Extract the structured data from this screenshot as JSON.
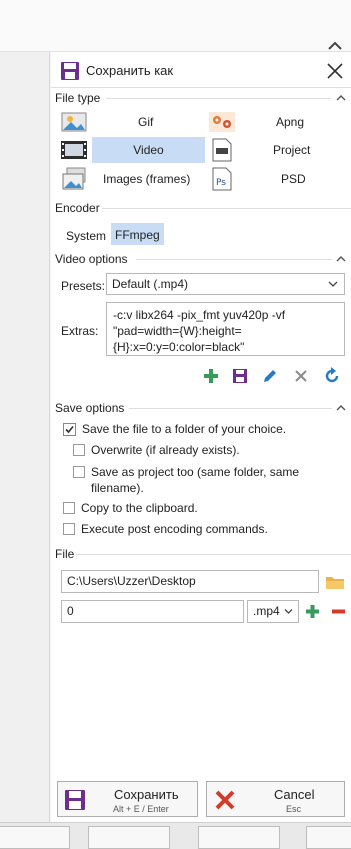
{
  "window": {
    "title": "Сохранить как"
  },
  "file_type": {
    "header": "File type",
    "items": [
      {
        "label": "Gif",
        "icon": "image-icon",
        "selected": false
      },
      {
        "label": "Apng",
        "icon": "flowers-icon",
        "selected": false
      },
      {
        "label": "Video",
        "icon": "film-icon",
        "selected": true
      },
      {
        "label": "Project",
        "icon": "project-file-icon",
        "selected": false
      },
      {
        "label": "Images (frames)",
        "icon": "images-icon",
        "selected": false
      },
      {
        "label": "PSD",
        "icon": "photoshop-file-icon",
        "selected": false
      }
    ]
  },
  "encoder": {
    "header": "Encoder",
    "tabs": [
      "System",
      "FFmpeg"
    ],
    "active_tab": "FFmpeg"
  },
  "video_options": {
    "header": "Video options",
    "presets_label": "Presets:",
    "presets_value": "Default (.mp4)",
    "extras_label": "Extras:",
    "extras_value": "-c:v libx264 -pix_fmt yuv420p -vf \"pad=width={W}:height={H}:x=0:y=0:color=black\""
  },
  "save_options": {
    "header": "Save options",
    "items": [
      {
        "label": "Save the file to a folder of your choice.",
        "checked": true
      },
      {
        "label": "Overwrite (if already exists).",
        "checked": false
      },
      {
        "label": "Save as project too (same folder, same filename).",
        "checked": false
      },
      {
        "label": "Copy to the clipboard.",
        "checked": false
      },
      {
        "label": "Execute post encoding commands.",
        "checked": false
      }
    ]
  },
  "file": {
    "header": "File",
    "folder": "C:\\Users\\Uzzer\\Desktop",
    "filename": "0",
    "extension": ".mp4"
  },
  "footer": {
    "save_label": "Сохранить",
    "save_shortcut": "Alt + E / Enter",
    "cancel_label": "Cancel",
    "cancel_shortcut": "Esc"
  },
  "colors": {
    "accent": "#6c2f8f",
    "selection": "#c8dcf5",
    "green": "#3a9a5b",
    "red": "#d23b2a",
    "blue": "#2a79c4"
  }
}
